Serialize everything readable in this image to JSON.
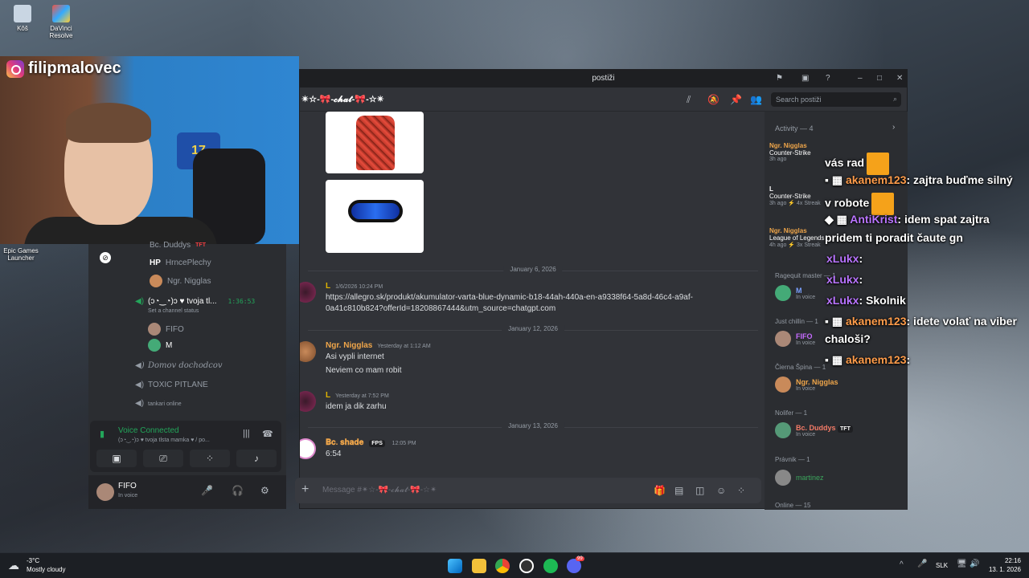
{
  "desktop": {
    "icons": [
      {
        "label": "Kôš"
      },
      {
        "label": "DaVinci Resolve"
      },
      {
        "label": "Epic Games Launcher"
      }
    ]
  },
  "webcam": {
    "instagram_handle": "filipmalovec",
    "jersey_number": "17"
  },
  "left_sidebar": {
    "channel_items": [
      {
        "label": "Bc. Duddys",
        "badge": "TFT"
      },
      {
        "label": "HrncePlechy",
        "prefix": "HP"
      },
      {
        "label": "Ngr. Nigglas"
      }
    ],
    "voice_channel": {
      "name": "(ɔ◔‿◔)ɔ ♥ tvoja tl...",
      "timer": "1:36:53",
      "status_hint": "Set a channel status",
      "members": [
        "FIFO",
        "M"
      ]
    },
    "other_channels": [
      "Domov dochodcov",
      "TOXIC PITLANE",
      "tankari online"
    ],
    "voice_connected": {
      "title": "Voice Connected",
      "subtitle": "(ɔ◔‿◔)ɔ ♥ tvoja tlsta mamka ♥ / po..."
    },
    "user": {
      "name": "FIFO",
      "status": "In voice"
    }
  },
  "window": {
    "title": "postiži",
    "channel_name": "✴☆-🎀-𝓬𝓱𝓪𝓽-🎀-☆✴",
    "search_placeholder": "Search postiži",
    "composer_placeholder": "Message #✴☆-🎀-𝓬𝓱𝓪𝓽-🎀-☆✴"
  },
  "messages": {
    "dividers": [
      "January 6, 2026",
      "January 12, 2026",
      "January 13, 2026"
    ],
    "items": [
      {
        "author": "L",
        "time": "1/6/2026 10:24 PM",
        "lines": [
          "https://allegro.sk/produkt/akumulator-varta-blue-dynamic-b18-44ah-440a-en-a9338f64-5a8d-46c4-a9af-",
          "0a41c810b824?offerId=18208867444&utm_source=chatgpt.com"
        ],
        "color": "#e0b400"
      },
      {
        "author": "Ngr. Nigglas",
        "time": "Yesterday at 1:12 AM",
        "lines": [
          "Asi vypli internet",
          "Neviem co mam robit"
        ],
        "color": "#f0a64a"
      },
      {
        "author": "L",
        "time": "Yesterday at 7:52 PM",
        "lines": [
          "idem ja dik zarhu"
        ],
        "color": "#e0b400"
      },
      {
        "author": "𝐁𝐜. 𝐬𝐡𝐚𝐝𝐞",
        "tag": "FPS",
        "time": "12:05 PM",
        "lines": [
          "6:54"
        ],
        "color": "#f0a64a"
      }
    ]
  },
  "right_panel": {
    "activity_header": "Activity — 4",
    "activity_cards": [
      {
        "name": "Ngr. Nigglas",
        "game": "Counter-Strike",
        "time": "3h ago"
      },
      {
        "name": "L",
        "game": "Counter-Strike",
        "time": "3h ago",
        "streak": "4x Streak"
      },
      {
        "name": "Ngr. Nigglas",
        "game": "League of Legends",
        "time": "4h ago",
        "streak": "3x Streak"
      }
    ],
    "groups": [
      {
        "header": "Ragequit master — 1",
        "member": "M",
        "status": "In voice"
      },
      {
        "header": "Just chillin — 1",
        "member": "FIFO",
        "status": "In voice"
      },
      {
        "header": "Čierna Špina — 1",
        "member": "Ngr. Nigglas",
        "status": "In voice"
      },
      {
        "header": "Nolifer — 1",
        "member": "Bc. Duddys",
        "badge": "TFT",
        "status": "In voice"
      },
      {
        "header": "Právnik — 1",
        "member": "martinez",
        "status": ""
      },
      {
        "header": "Online — 15"
      }
    ]
  },
  "overlay_chat": [
    {
      "text": "vás rad"
    },
    {
      "user": "akanem123",
      "text": ": zajtra buďme silný"
    },
    {
      "text": "v robote"
    },
    {
      "user": "AntiKrist",
      "text": ": idem spat zajtra"
    },
    {
      "text": "pridem ti poradit čaute gn"
    },
    {
      "user": "xLukx",
      "text": ":"
    },
    {
      "user": "xLukx",
      "text": ":"
    },
    {
      "user": "xLukx",
      "text": ": Skolnik"
    },
    {
      "user": "akanem123",
      "text": ": idete volať na viber"
    },
    {
      "text": "chaloši?"
    },
    {
      "user": "akanem123",
      "text": ":"
    }
  ],
  "taskbar": {
    "weather_temp": "-3°C",
    "weather_desc": "Mostly cloudy",
    "lang": "SLK",
    "time": "22:16",
    "date": "13. 1. 2026",
    "discord_badge": "99"
  }
}
